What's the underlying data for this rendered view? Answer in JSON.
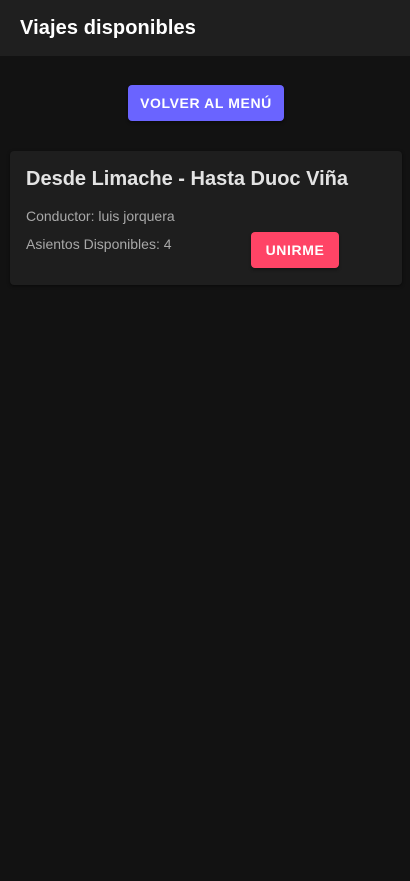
{
  "header": {
    "title": "Viajes disponibles"
  },
  "actions": {
    "back_label": "VOLVER AL MENÚ"
  },
  "trips": [
    {
      "title": "Desde Limache - Hasta Duoc Viña",
      "driver_label": "Conductor:",
      "driver": "luis jorquera",
      "seats_label": "Asientos Disponibles:",
      "seats": "4",
      "join_label": "UNIRME"
    }
  ],
  "colors": {
    "background": "#121212",
    "toolbar": "#1f1f1f",
    "card": "#1e1e1e",
    "primary": "#6a64ff",
    "danger": "#ff4466"
  }
}
